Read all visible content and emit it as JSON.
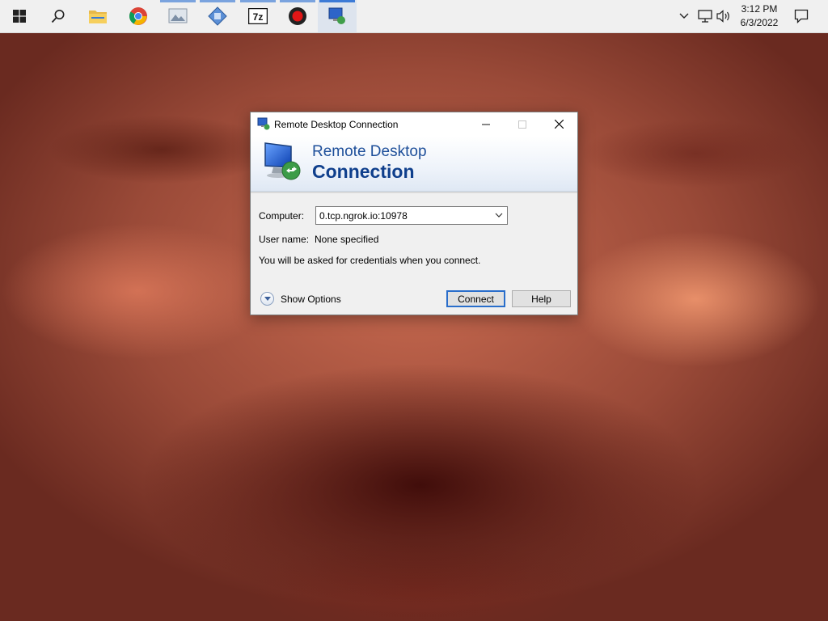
{
  "taskbar": {
    "pinned": [
      {
        "name": "start-button",
        "icon": "windows-logo-icon"
      },
      {
        "name": "search-button",
        "icon": "search-icon"
      },
      {
        "name": "file-explorer-button",
        "icon": "folder-icon"
      },
      {
        "name": "chrome-button",
        "icon": "chrome-icon"
      },
      {
        "name": "app-button-image-viewer",
        "icon": "image-viewer-icon"
      },
      {
        "name": "app-button-network",
        "icon": "network-tool-icon"
      },
      {
        "name": "app-button-7zip",
        "icon": "7zip-icon"
      },
      {
        "name": "app-button-recorder",
        "icon": "record-icon"
      },
      {
        "name": "app-button-remote-desktop",
        "icon": "remote-desktop-icon"
      }
    ],
    "tray": {
      "time": "3:12 PM",
      "date": "6/3/2022"
    },
    "accent_color": "#3c7ad6"
  },
  "dialog": {
    "title": "Remote Desktop Connection",
    "banner": {
      "line1": "Remote Desktop",
      "line2": "Connection"
    },
    "computer_label": "Computer:",
    "computer_value": "0.tcp.ngrok.io:10978",
    "username_label": "User name:",
    "username_value": "None specified",
    "info_text": "You will be asked for credentials when you connect.",
    "show_options_label": "Show Options",
    "connect_label": "Connect",
    "help_label": "Help"
  }
}
